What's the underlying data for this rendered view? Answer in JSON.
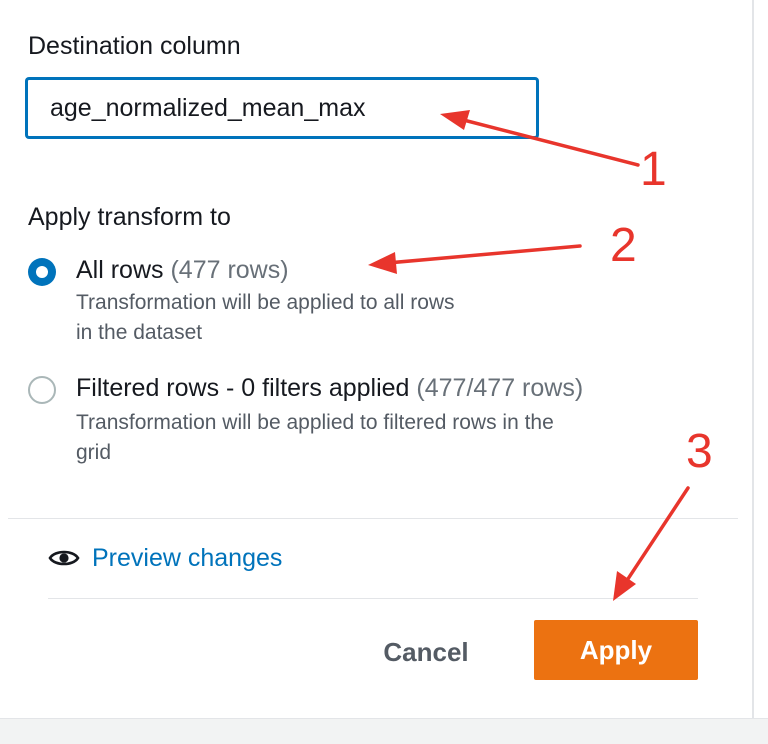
{
  "destination": {
    "label": "Destination column",
    "value": "age_normalized_mean_max"
  },
  "apply_transform": {
    "label": "Apply transform to",
    "options": [
      {
        "title": "All rows",
        "count": "(477 rows)",
        "description_line1": "Transformation will be applied to all rows",
        "description_line2": "in the dataset",
        "selected": true
      },
      {
        "title": "Filtered rows - 0 filters applied",
        "count": "(477/477 rows)",
        "description_line1": "Transformation will be applied to filtered rows in the",
        "description_line2": "grid",
        "selected": false
      }
    ]
  },
  "preview": {
    "label": "Preview changes",
    "icon": "eye-icon"
  },
  "footer": {
    "cancel_label": "Cancel",
    "apply_label": "Apply"
  },
  "annotations": [
    "1",
    "2",
    "3"
  ],
  "colors": {
    "accent": "#0073bb",
    "primary_button": "#ec7211",
    "annotation": "#e8352c"
  }
}
